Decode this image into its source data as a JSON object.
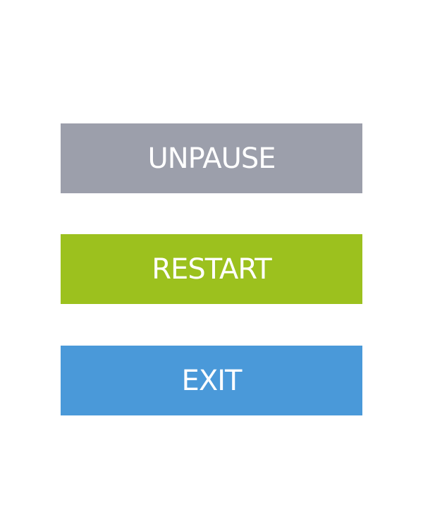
{
  "pause_menu": {
    "buttons": [
      {
        "id": "unpause",
        "label": "UNPAUSE",
        "color": "#9c9fab"
      },
      {
        "id": "restart",
        "label": "RESTART",
        "color": "#9cc11e"
      },
      {
        "id": "exit",
        "label": "EXIT",
        "color": "#4a99d9"
      }
    ]
  }
}
